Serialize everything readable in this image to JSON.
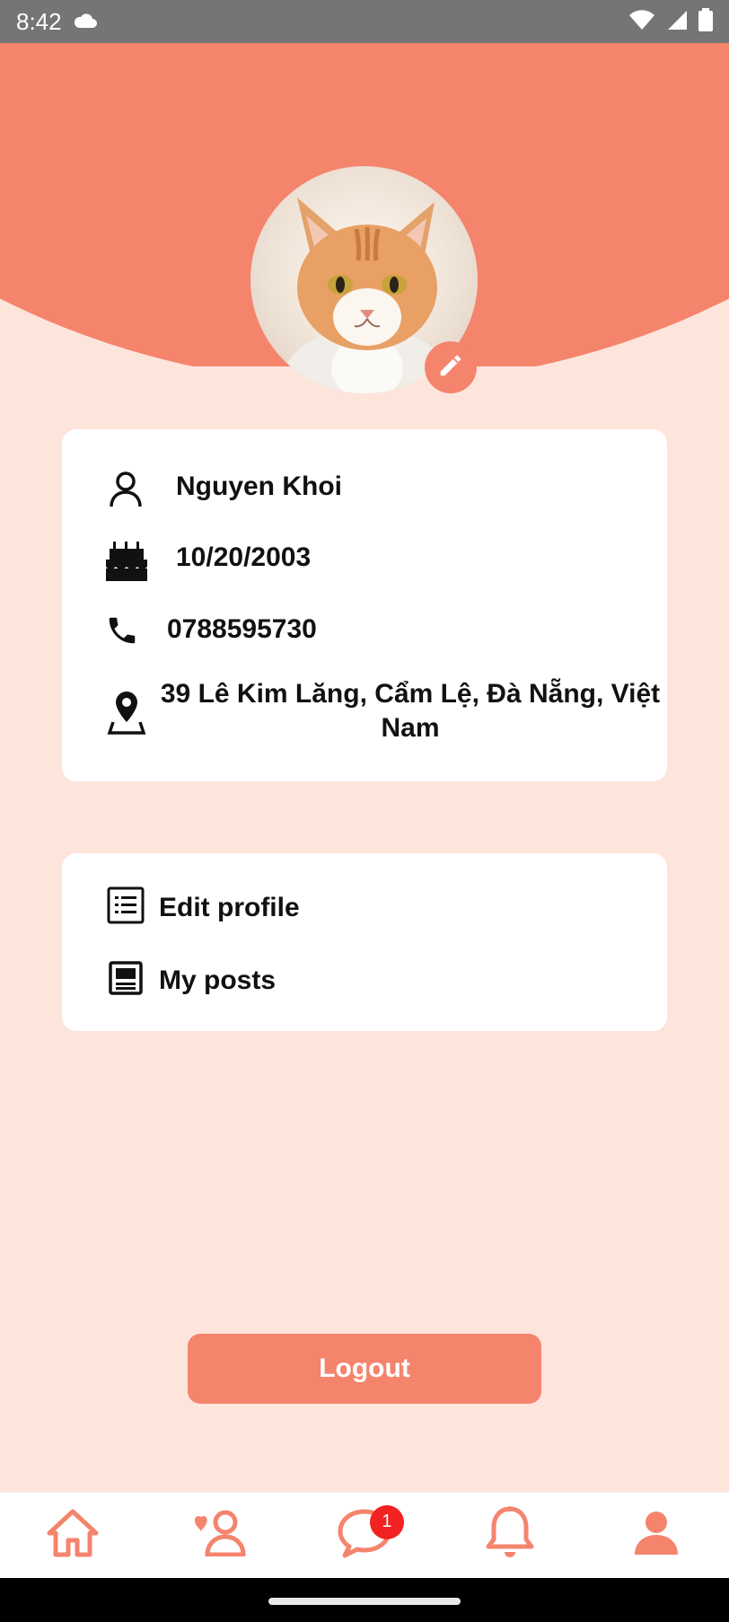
{
  "status_bar": {
    "time": "8:42",
    "icons": [
      "cloud-icon",
      "wifi-icon",
      "signal-icon",
      "battery-icon"
    ]
  },
  "profile": {
    "name": "Nguyen Khoi",
    "birthday": "10/20/2003",
    "phone": "0788595730",
    "address": "39 Lê Kim Lăng, Cẩm Lệ, Đà Nẵng, Việt Nam"
  },
  "menu": {
    "edit_profile": "Edit profile",
    "my_posts": "My posts"
  },
  "logout_label": "Logout",
  "bottom_nav": {
    "items": [
      "home-icon",
      "friends-icon",
      "chat-icon",
      "bell-icon",
      "profile-icon"
    ],
    "chat_badge": "1"
  },
  "colors": {
    "accent": "#f5846d",
    "background": "#fde5dc",
    "badge": "#f22222"
  }
}
